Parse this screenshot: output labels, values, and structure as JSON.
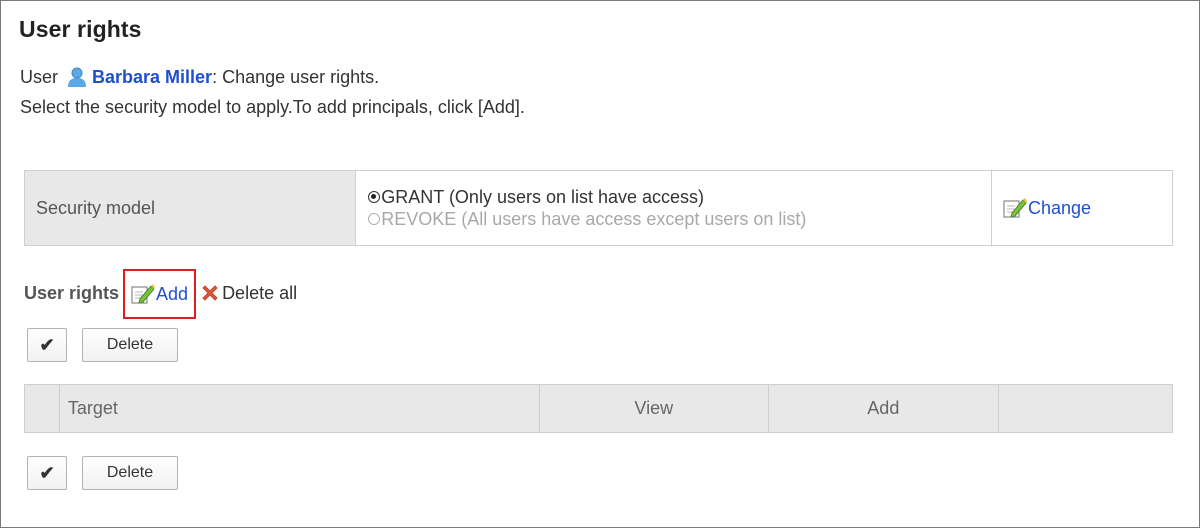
{
  "title": "User rights",
  "description": {
    "prefix": "User",
    "user_name": "Barbara Miller",
    "suffix": ": Change user rights.",
    "line2": "Select the security model to apply.To add principals, click [Add]."
  },
  "security": {
    "label": "Security model",
    "options": [
      {
        "label": "GRANT (Only users on list have access)",
        "selected": true
      },
      {
        "label": "REVOKE (All users have access except users on list)",
        "selected": false
      }
    ],
    "change_label": "Change"
  },
  "rights": {
    "label": "User rights",
    "add_label": "Add",
    "delete_all_label": "Delete all"
  },
  "buttons": {
    "check": "✔",
    "delete": "Delete"
  },
  "table": {
    "headers": [
      "",
      "Target",
      "View",
      "Add",
      ""
    ]
  },
  "colors": {
    "link": "#1f4fcf",
    "highlight": "#e01e1e",
    "header_bg": "#e8e8e8"
  }
}
